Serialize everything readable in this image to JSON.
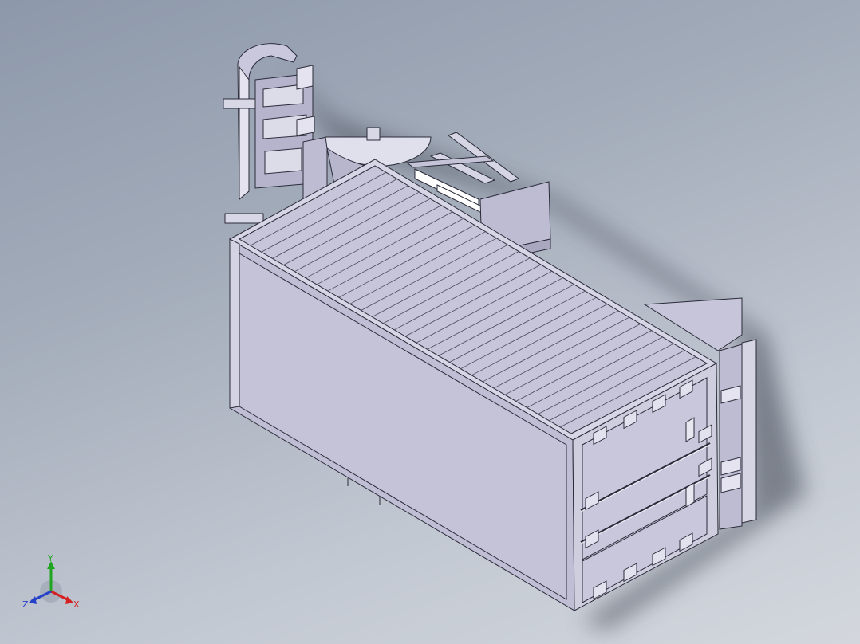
{
  "viewport": {
    "background_top": "#8d98aa",
    "background_bottom": "#d3d7dd"
  },
  "model": {
    "description_icon": "container-assembly-3d",
    "body_color": "#c9c8dc",
    "edge_color": "#2b2b3a",
    "shadow_color": "#3c4250"
  },
  "triad": {
    "x_label": "X",
    "y_label": "Y",
    "z_label": "Z",
    "x_color": "#d42020",
    "y_color": "#1fa51f",
    "z_color": "#2640c8"
  }
}
